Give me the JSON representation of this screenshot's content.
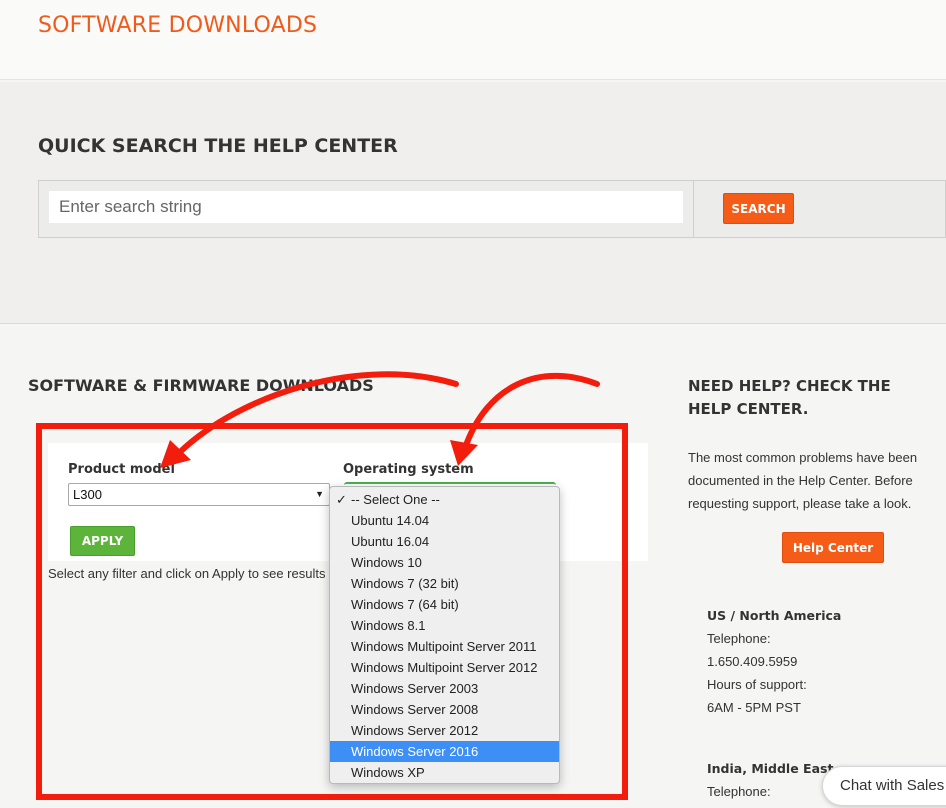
{
  "header": {
    "title": "SOFTWARE DOWNLOADS"
  },
  "quick_search": {
    "heading": "QUICK SEARCH THE HELP CENTER",
    "placeholder": "Enter search string",
    "button_label": "SEARCH"
  },
  "downloads": {
    "heading": "SOFTWARE & FIRMWARE DOWNLOADS",
    "product_label": "Product model",
    "product_value": "L300",
    "os_label": "Operating system",
    "apply_label": "APPLY",
    "hint": "Select any filter and click on Apply to see results"
  },
  "os_dropdown": {
    "checked_index": 0,
    "highlighted_index": 12,
    "options": [
      "-- Select One --",
      "Ubuntu 14.04",
      "Ubuntu 16.04",
      "Windows 10",
      "Windows 7 (32 bit)",
      "Windows 7 (64 bit)",
      "Windows 8.1",
      "Windows Multipoint Server 2011",
      "Windows Multipoint Server 2012",
      "Windows Server 2003",
      "Windows Server 2008",
      "Windows Server 2012",
      "Windows Server 2016",
      "Windows XP"
    ]
  },
  "help": {
    "heading": "NEED HELP? CHECK THE HELP CENTER.",
    "text": "The most common problems have been documented in the Help Center. Before requesting support, please take a look.",
    "button_label": "Help Center"
  },
  "contacts": [
    {
      "region": "US / North America",
      "lines": [
        "Telephone:",
        "1.650.409.5959",
        "Hours of support:",
        "6AM - 5PM PST"
      ]
    },
    {
      "region": "India, Middle East",
      "lines": [
        "Telephone:"
      ]
    }
  ],
  "chat": {
    "label": "Chat with Sales"
  },
  "colors": {
    "brand_orange": "#f45c17",
    "apply_green": "#5cb53a",
    "annotation_red": "#f21d0d",
    "selection_blue": "#3d8ff5"
  }
}
